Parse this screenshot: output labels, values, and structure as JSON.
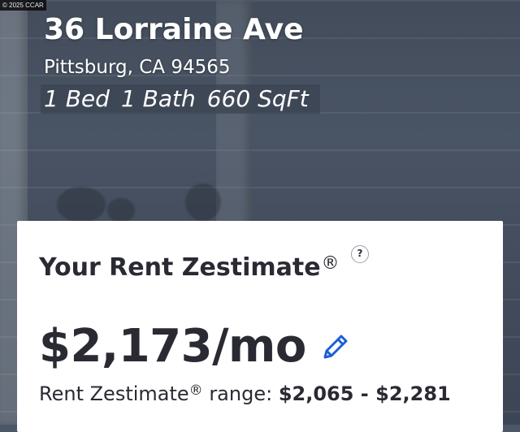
{
  "photo": {
    "copyright": "© 2025 CCAR"
  },
  "property": {
    "street": "36 Lorraine Ave",
    "city_state_zip": "Pittsburg, CA 94565",
    "beds": "1 Bed",
    "baths": "1 Bath",
    "sqft": "660 SqFt"
  },
  "rent_zestimate": {
    "title": "Your Rent Zestimate",
    "registered_mark": "®",
    "help_symbol": "?",
    "price": "$2,173/mo",
    "range_label": "Rent Zestimate",
    "range_suffix": "range:",
    "range_values": "$2,065 - $2,281"
  },
  "colors": {
    "text_dark": "#2a2a33",
    "edit_icon": "#1a5fd6",
    "card_bg": "#ffffff"
  },
  "icons": {
    "help": "question-circle-icon",
    "edit": "pencil-icon"
  }
}
